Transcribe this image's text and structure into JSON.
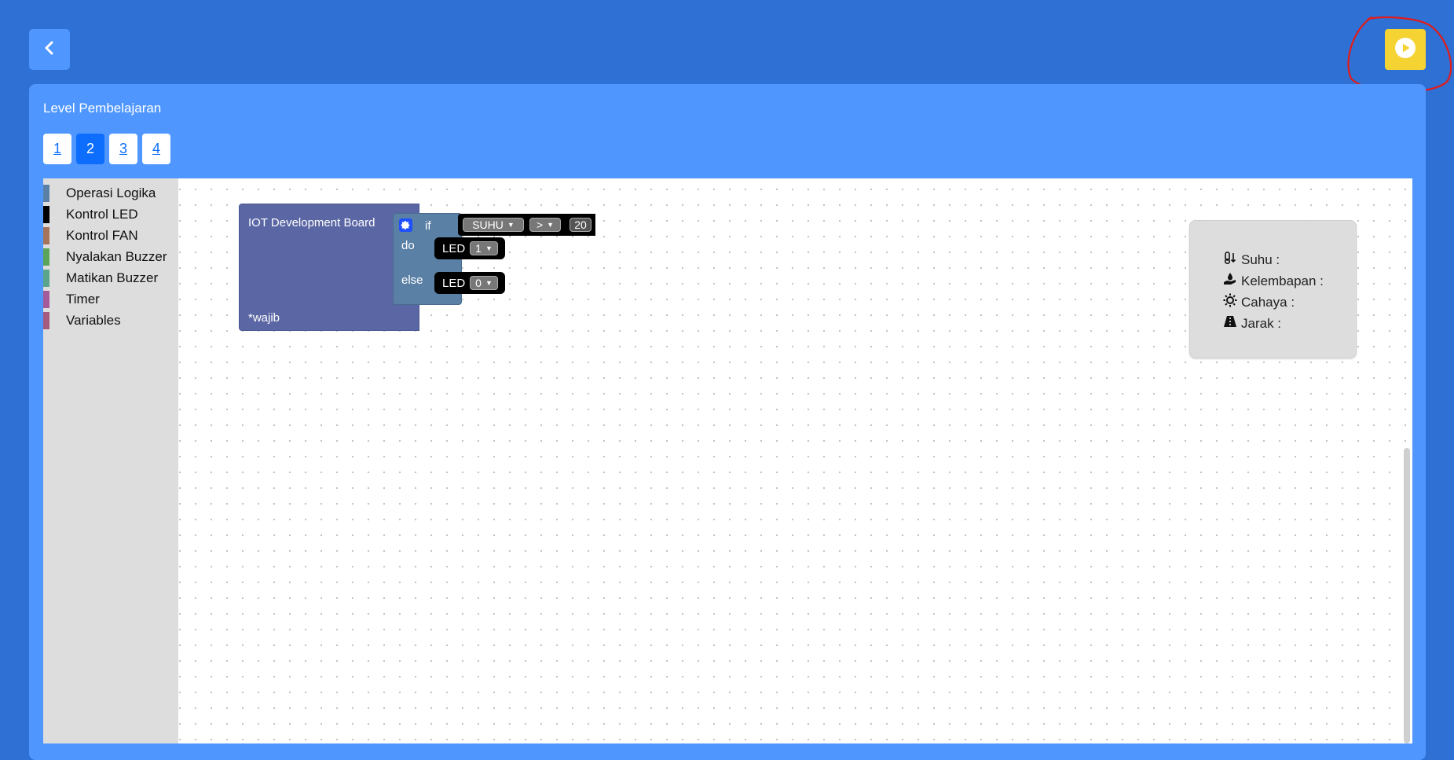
{
  "panel": {
    "title": "Level Pembelajaran"
  },
  "levels": [
    {
      "label": "1",
      "active": false
    },
    {
      "label": "2",
      "active": true
    },
    {
      "label": "3",
      "active": false
    },
    {
      "label": "4",
      "active": false
    }
  ],
  "toolbox": {
    "categories": [
      {
        "label": "Operasi Logika",
        "color": "#5b80a5"
      },
      {
        "label": "Kontrol LED",
        "color": "#000000"
      },
      {
        "label": "Kontrol FAN",
        "color": "#a5745b"
      },
      {
        "label": "Nyalakan Buzzer",
        "color": "#5ba55b"
      },
      {
        "label": "Matikan Buzzer",
        "color": "#5ba58c"
      },
      {
        "label": "Timer",
        "color": "#a55b99"
      },
      {
        "label": "Variables",
        "color": "#a55b80"
      }
    ]
  },
  "blocks": {
    "board": {
      "title": "IOT Development Board",
      "note": "*wajib"
    },
    "if_block": {
      "if_label": "if",
      "do_label": "do",
      "else_label": "else",
      "condition": {
        "variable": "SUHU",
        "operator": ">",
        "value": "20"
      },
      "do_action": {
        "label": "LED",
        "value": "1"
      },
      "else_action": {
        "label": "LED",
        "value": "0"
      }
    }
  },
  "sensors": [
    {
      "label": "Suhu :",
      "icon": "thermometer-icon"
    },
    {
      "label": "Kelembapan :",
      "icon": "hand-droplet-icon"
    },
    {
      "label": "Cahaya :",
      "icon": "sun-icon"
    },
    {
      "label": "Jarak :",
      "icon": "road-icon"
    }
  ],
  "colors": {
    "background": "#2e70d3",
    "panel": "#4f96ff",
    "run_button": "#f5d333",
    "active_level": "#0d6efd"
  }
}
